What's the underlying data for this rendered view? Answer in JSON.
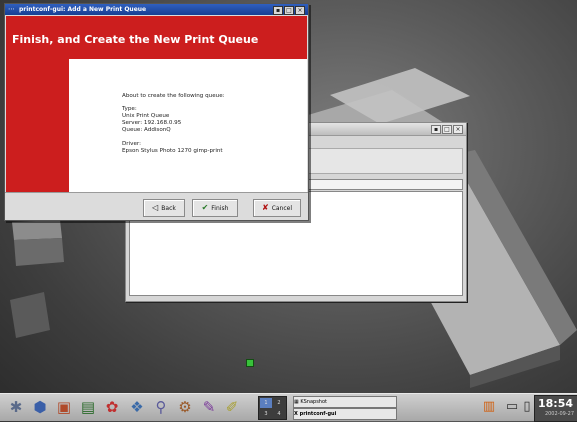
{
  "dialog": {
    "title": "printconf-gui: Add a New Print Queue",
    "header": "Finish, and Create the New Print Queue",
    "intro": "About to create the following queue:",
    "type_label": "Type:",
    "type_value": "Unix Print Queue",
    "server": "Server: 192.168.0.95",
    "queue": "Queue: AddisonQ",
    "driver_label": "Driver:",
    "driver_value": "Epson Stylus Photo 1270 gimp-print",
    "buttons": {
      "back": "Back",
      "finish": "Finish",
      "cancel": "Cancel"
    }
  },
  "window_controls": {
    "minimize": "▪",
    "maximize": "□",
    "close": "×"
  },
  "taskbar": {
    "pager": [
      "1",
      "2",
      "3",
      "4"
    ],
    "tasks": [
      {
        "label": "KSnapshot"
      },
      {
        "label": "printconf-gui"
      }
    ],
    "clock": {
      "time": "18:54",
      "date": "2002-09-27"
    }
  },
  "colors": {
    "accent_red": "#cc1e1e",
    "titlebar_blue": "#173f93",
    "indicator_green": "#38c13a"
  }
}
